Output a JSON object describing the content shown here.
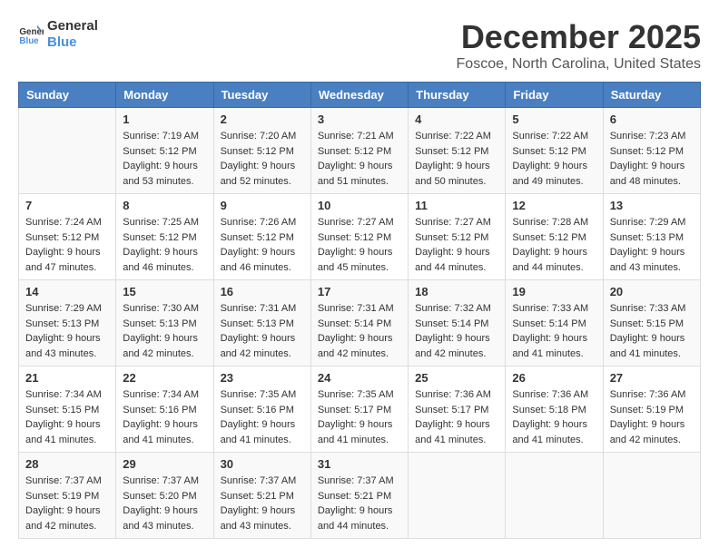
{
  "header": {
    "logo_line1": "General",
    "logo_line2": "Blue",
    "month": "December 2025",
    "location": "Foscoe, North Carolina, United States"
  },
  "weekdays": [
    "Sunday",
    "Monday",
    "Tuesday",
    "Wednesday",
    "Thursday",
    "Friday",
    "Saturday"
  ],
  "weeks": [
    [
      {
        "day": "",
        "sunrise": "",
        "sunset": "",
        "daylight": ""
      },
      {
        "day": "1",
        "sunrise": "Sunrise: 7:19 AM",
        "sunset": "Sunset: 5:12 PM",
        "daylight": "Daylight: 9 hours and 53 minutes."
      },
      {
        "day": "2",
        "sunrise": "Sunrise: 7:20 AM",
        "sunset": "Sunset: 5:12 PM",
        "daylight": "Daylight: 9 hours and 52 minutes."
      },
      {
        "day": "3",
        "sunrise": "Sunrise: 7:21 AM",
        "sunset": "Sunset: 5:12 PM",
        "daylight": "Daylight: 9 hours and 51 minutes."
      },
      {
        "day": "4",
        "sunrise": "Sunrise: 7:22 AM",
        "sunset": "Sunset: 5:12 PM",
        "daylight": "Daylight: 9 hours and 50 minutes."
      },
      {
        "day": "5",
        "sunrise": "Sunrise: 7:22 AM",
        "sunset": "Sunset: 5:12 PM",
        "daylight": "Daylight: 9 hours and 49 minutes."
      },
      {
        "day": "6",
        "sunrise": "Sunrise: 7:23 AM",
        "sunset": "Sunset: 5:12 PM",
        "daylight": "Daylight: 9 hours and 48 minutes."
      }
    ],
    [
      {
        "day": "7",
        "sunrise": "Sunrise: 7:24 AM",
        "sunset": "Sunset: 5:12 PM",
        "daylight": "Daylight: 9 hours and 47 minutes."
      },
      {
        "day": "8",
        "sunrise": "Sunrise: 7:25 AM",
        "sunset": "Sunset: 5:12 PM",
        "daylight": "Daylight: 9 hours and 46 minutes."
      },
      {
        "day": "9",
        "sunrise": "Sunrise: 7:26 AM",
        "sunset": "Sunset: 5:12 PM",
        "daylight": "Daylight: 9 hours and 46 minutes."
      },
      {
        "day": "10",
        "sunrise": "Sunrise: 7:27 AM",
        "sunset": "Sunset: 5:12 PM",
        "daylight": "Daylight: 9 hours and 45 minutes."
      },
      {
        "day": "11",
        "sunrise": "Sunrise: 7:27 AM",
        "sunset": "Sunset: 5:12 PM",
        "daylight": "Daylight: 9 hours and 44 minutes."
      },
      {
        "day": "12",
        "sunrise": "Sunrise: 7:28 AM",
        "sunset": "Sunset: 5:12 PM",
        "daylight": "Daylight: 9 hours and 44 minutes."
      },
      {
        "day": "13",
        "sunrise": "Sunrise: 7:29 AM",
        "sunset": "Sunset: 5:13 PM",
        "daylight": "Daylight: 9 hours and 43 minutes."
      }
    ],
    [
      {
        "day": "14",
        "sunrise": "Sunrise: 7:29 AM",
        "sunset": "Sunset: 5:13 PM",
        "daylight": "Daylight: 9 hours and 43 minutes."
      },
      {
        "day": "15",
        "sunrise": "Sunrise: 7:30 AM",
        "sunset": "Sunset: 5:13 PM",
        "daylight": "Daylight: 9 hours and 42 minutes."
      },
      {
        "day": "16",
        "sunrise": "Sunrise: 7:31 AM",
        "sunset": "Sunset: 5:13 PM",
        "daylight": "Daylight: 9 hours and 42 minutes."
      },
      {
        "day": "17",
        "sunrise": "Sunrise: 7:31 AM",
        "sunset": "Sunset: 5:14 PM",
        "daylight": "Daylight: 9 hours and 42 minutes."
      },
      {
        "day": "18",
        "sunrise": "Sunrise: 7:32 AM",
        "sunset": "Sunset: 5:14 PM",
        "daylight": "Daylight: 9 hours and 42 minutes."
      },
      {
        "day": "19",
        "sunrise": "Sunrise: 7:33 AM",
        "sunset": "Sunset: 5:14 PM",
        "daylight": "Daylight: 9 hours and 41 minutes."
      },
      {
        "day": "20",
        "sunrise": "Sunrise: 7:33 AM",
        "sunset": "Sunset: 5:15 PM",
        "daylight": "Daylight: 9 hours and 41 minutes."
      }
    ],
    [
      {
        "day": "21",
        "sunrise": "Sunrise: 7:34 AM",
        "sunset": "Sunset: 5:15 PM",
        "daylight": "Daylight: 9 hours and 41 minutes."
      },
      {
        "day": "22",
        "sunrise": "Sunrise: 7:34 AM",
        "sunset": "Sunset: 5:16 PM",
        "daylight": "Daylight: 9 hours and 41 minutes."
      },
      {
        "day": "23",
        "sunrise": "Sunrise: 7:35 AM",
        "sunset": "Sunset: 5:16 PM",
        "daylight": "Daylight: 9 hours and 41 minutes."
      },
      {
        "day": "24",
        "sunrise": "Sunrise: 7:35 AM",
        "sunset": "Sunset: 5:17 PM",
        "daylight": "Daylight: 9 hours and 41 minutes."
      },
      {
        "day": "25",
        "sunrise": "Sunrise: 7:36 AM",
        "sunset": "Sunset: 5:17 PM",
        "daylight": "Daylight: 9 hours and 41 minutes."
      },
      {
        "day": "26",
        "sunrise": "Sunrise: 7:36 AM",
        "sunset": "Sunset: 5:18 PM",
        "daylight": "Daylight: 9 hours and 41 minutes."
      },
      {
        "day": "27",
        "sunrise": "Sunrise: 7:36 AM",
        "sunset": "Sunset: 5:19 PM",
        "daylight": "Daylight: 9 hours and 42 minutes."
      }
    ],
    [
      {
        "day": "28",
        "sunrise": "Sunrise: 7:37 AM",
        "sunset": "Sunset: 5:19 PM",
        "daylight": "Daylight: 9 hours and 42 minutes."
      },
      {
        "day": "29",
        "sunrise": "Sunrise: 7:37 AM",
        "sunset": "Sunset: 5:20 PM",
        "daylight": "Daylight: 9 hours and 43 minutes."
      },
      {
        "day": "30",
        "sunrise": "Sunrise: 7:37 AM",
        "sunset": "Sunset: 5:21 PM",
        "daylight": "Daylight: 9 hours and 43 minutes."
      },
      {
        "day": "31",
        "sunrise": "Sunrise: 7:37 AM",
        "sunset": "Sunset: 5:21 PM",
        "daylight": "Daylight: 9 hours and 44 minutes."
      },
      {
        "day": "",
        "sunrise": "",
        "sunset": "",
        "daylight": ""
      },
      {
        "day": "",
        "sunrise": "",
        "sunset": "",
        "daylight": ""
      },
      {
        "day": "",
        "sunrise": "",
        "sunset": "",
        "daylight": ""
      }
    ]
  ]
}
